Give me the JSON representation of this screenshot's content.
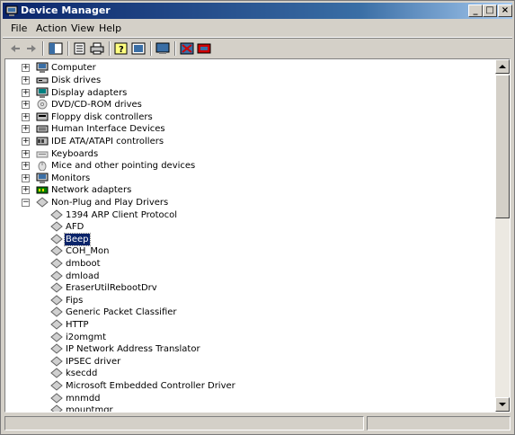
{
  "window": {
    "title": "Device Manager"
  },
  "menu": {
    "items": [
      {
        "label": "File"
      },
      {
        "label": "Action"
      },
      {
        "label": "View"
      },
      {
        "label": "Help"
      }
    ]
  },
  "toolbar": {
    "buttons": [
      "back-icon",
      "forward-icon",
      "show-hide-tree-icon",
      "properties-icon",
      "print-icon",
      "help-icon",
      "refresh-icon",
      "scan-hardware-icon",
      "disable-device-icon",
      "uninstall-device-icon"
    ]
  },
  "tree": {
    "categories": [
      {
        "label": "Computer",
        "icon": "computer-icon"
      },
      {
        "label": "Disk drives",
        "icon": "disk-drive-icon"
      },
      {
        "label": "Display adapters",
        "icon": "display-adapter-icon"
      },
      {
        "label": "DVD/CD-ROM drives",
        "icon": "cdrom-icon"
      },
      {
        "label": "Floppy disk controllers",
        "icon": "floppy-controller-icon"
      },
      {
        "label": "Human Interface Devices",
        "icon": "hid-icon"
      },
      {
        "label": "IDE ATA/ATAPI controllers",
        "icon": "ide-controller-icon"
      },
      {
        "label": "Keyboards",
        "icon": "keyboard-icon"
      },
      {
        "label": "Mice and other pointing devices",
        "icon": "mouse-icon"
      },
      {
        "label": "Monitors",
        "icon": "monitor-icon"
      },
      {
        "label": "Network adapters",
        "icon": "network-adapter-icon"
      },
      {
        "label": "Non-Plug and Play Drivers",
        "icon": "driver-icon",
        "expanded": true
      }
    ],
    "drivers": [
      {
        "label": "1394 ARP Client Protocol"
      },
      {
        "label": "AFD"
      },
      {
        "label": "Beep",
        "selected": true
      },
      {
        "label": "COH_Mon"
      },
      {
        "label": "dmboot"
      },
      {
        "label": "dmload"
      },
      {
        "label": "EraserUtilRebootDrv"
      },
      {
        "label": "Fips"
      },
      {
        "label": "Generic Packet Classifier"
      },
      {
        "label": "HTTP"
      },
      {
        "label": "i2omgmt"
      },
      {
        "label": "IP Network Address Translator"
      },
      {
        "label": "IPSEC driver"
      },
      {
        "label": "ksecdd"
      },
      {
        "label": "Microsoft Embedded Controller Driver"
      },
      {
        "label": "mnmdd"
      },
      {
        "label": "mountmgr"
      }
    ]
  },
  "colors": {
    "titlebar": "#0a246a",
    "selection": "#0a246a",
    "chrome": "#d4d0c8"
  }
}
